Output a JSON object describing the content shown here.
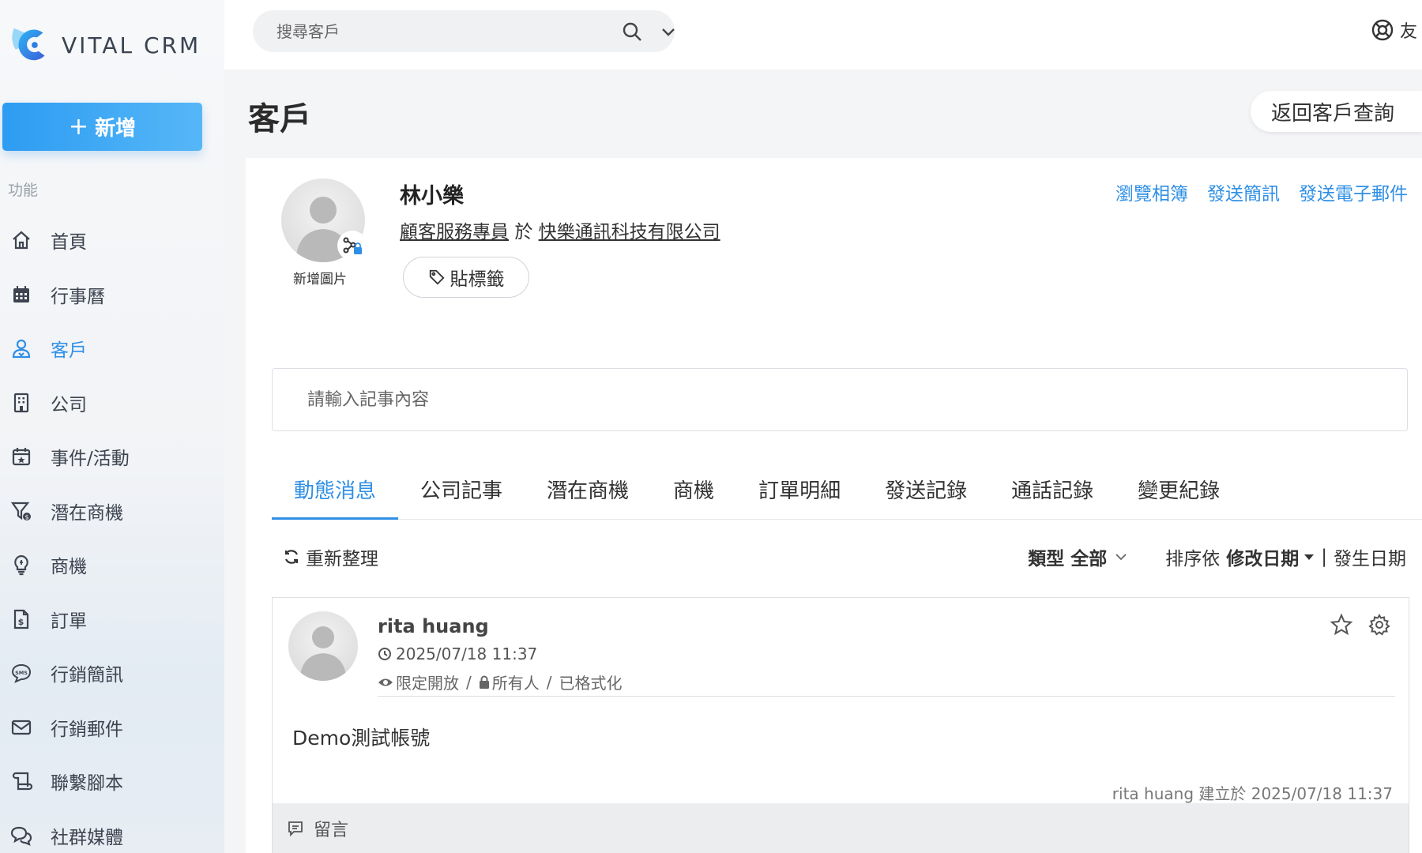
{
  "app": {
    "logo_text": "VITAL CRM",
    "accent_color": "#2f8fe6"
  },
  "sidebar": {
    "new_label": "新增",
    "section_label": "功能",
    "items": [
      {
        "label": "首頁",
        "icon": "home-icon"
      },
      {
        "label": "行事曆",
        "icon": "calendar-icon"
      },
      {
        "label": "客戶",
        "icon": "contact-icon",
        "active": true
      },
      {
        "label": "公司",
        "icon": "building-icon"
      },
      {
        "label": "事件/活動",
        "icon": "event-calendar-icon"
      },
      {
        "label": "潛在商機",
        "icon": "funnel-icon"
      },
      {
        "label": "商機",
        "icon": "lightbulb-icon"
      },
      {
        "label": "訂單",
        "icon": "order-document-icon"
      },
      {
        "label": "行銷簡訊",
        "icon": "sms-icon"
      },
      {
        "label": "行銷郵件",
        "icon": "mail-icon"
      },
      {
        "label": "聯繫腳本",
        "icon": "script-scroll-icon"
      },
      {
        "label": "社群媒體",
        "icon": "chat-bubbles-icon"
      }
    ]
  },
  "topbar": {
    "search_placeholder": "搜尋客戶",
    "help_label": "友"
  },
  "page": {
    "title": "客戶",
    "back_label": "返回客戶查詢"
  },
  "contact": {
    "name": "林小樂",
    "job_title": "顧客服務專員",
    "at_word": "於",
    "company": "快樂通訊科技有限公司",
    "add_photo_label": "新增圖片",
    "tag_label": "貼標籤",
    "actions": [
      "瀏覽相簿",
      "發送簡訊",
      "發送電子郵件"
    ]
  },
  "note": {
    "placeholder": "請輸入記事內容"
  },
  "tabs": [
    "動態消息",
    "公司記事",
    "潛在商機",
    "商機",
    "訂單明細",
    "發送記錄",
    "通話記錄",
    "變更紀錄"
  ],
  "toolbar": {
    "refresh_label": "重新整理",
    "type_label": "類型",
    "type_value": "全部",
    "sort_label": "排序依",
    "sort_active": "修改日期",
    "sort_separator": "|",
    "sort_alt": "發生日期"
  },
  "activity": {
    "author": "rita huang",
    "time": "2025/07/18 11:37",
    "privacy": "限定開放",
    "sep1": "/",
    "audience": "所有人",
    "sep2": "/",
    "format": "已格式化",
    "content": "Demo測試帳號",
    "created_by": "rita huang 建立於 2025/07/18 11:37",
    "comment_label": "留言"
  }
}
